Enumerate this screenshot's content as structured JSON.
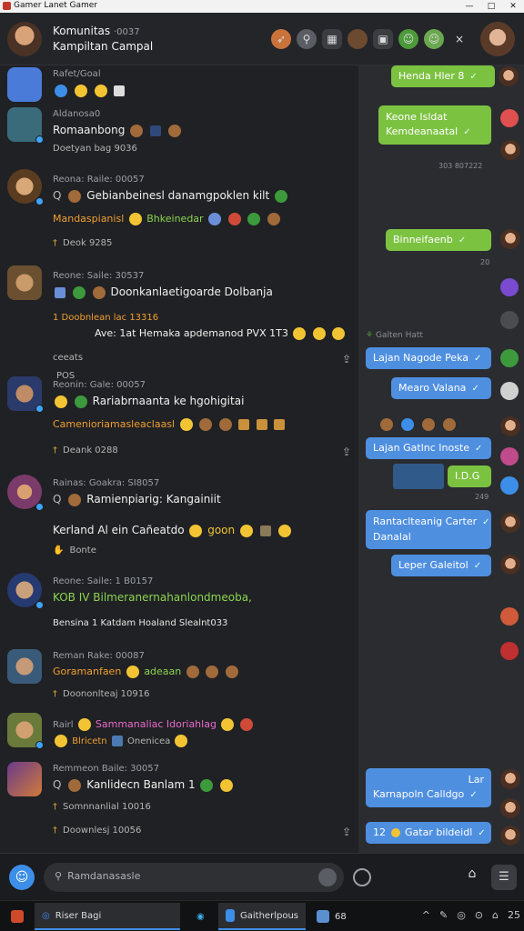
{
  "titlebar": {
    "title": "Gamer Lanet Gamer",
    "buttons": [
      "—",
      "□",
      "✕"
    ]
  },
  "header": {
    "title": "Komunitas",
    "title_meta": "·0037",
    "subtitle": "Kampiltan Campal",
    "icons": [
      "rocket-icon",
      "search-icon",
      "controller-icon",
      "avatar-icon",
      "sticker-icon",
      "emoji-icon",
      "emoji-icon",
      "close-icon"
    ],
    "close_glyph": "×"
  },
  "feed": {
    "posts": [
      {
        "meta": "Rafet/Goal",
        "line1": "",
        "line2": "",
        "footer": ""
      },
      {
        "meta": "Aldanosa0",
        "line1": "Romaanbong",
        "line2": "Doetyan bag 9036",
        "footer": ""
      },
      {
        "meta": "Reona: Raile: 00057",
        "prefix": "Q",
        "line1": "Gebianbeinesl danamgpoklen kilt",
        "line2": "Mandaspianisl",
        "line2b": "Bhkeinedar",
        "footer": "Deok 9285",
        "footer_prefix": "†"
      },
      {
        "meta": "Reone: Saile: 30537",
        "line1": "Doonkanlaetigoarde Dolbanja",
        "line2": "1 Doobnlean lac 13316",
        "line3": "Ave: 1at Hemaka apdemanod PVX 1T3",
        "footer": "POS",
        "footer_prefix": "ceeats"
      },
      {
        "meta": "Reonin: Gale: 00057",
        "line1": "Rariabrnaanta ke hgohigitai",
        "line2": "Camenioriamasleaclaasl",
        "footer": "Deank 0288",
        "footer_prefix": "†"
      },
      {
        "meta": "Rainas: Goakra: SI8057",
        "prefix": "Q",
        "line1": "Ramienpiarig: Kangainiit",
        "line2": "Kerland Al ein Cañeatdo",
        "line2b": "goon",
        "footer": "Bonte",
        "footer_prefix": "✋"
      },
      {
        "meta": "Reone: Saile: 1 B0157",
        "line1": "KOB IV Bilmeranernahanlondmeoba,",
        "line2": "Bensina 1 Katdam Hoaland Slealnt033",
        "footer": ""
      },
      {
        "meta": "Reman Rake: 00087",
        "line1": "Goramanfaen",
        "line1b": "adeaan",
        "footer": "Doononlteaj 10916",
        "footer_prefix": "†"
      },
      {
        "meta": "Rairl",
        "line1": "Sammanaliac Idoriahlag",
        "line2": "Blricetn",
        "line2b": "Onenicea",
        "footer": ""
      },
      {
        "meta": "Remmeon Baile: 30057",
        "prefix": "Q",
        "line1": "Kanlidecn Banlam 1",
        "line2": "Somnnanlial 10016",
        "line3": "Doownlesj 10056",
        "footer": ""
      }
    ]
  },
  "side": {
    "bubbles": [
      {
        "text": "Henda Hler 8",
        "color": "green"
      },
      {
        "text": "Keone Isldat",
        "text2": "Kemdeanaatal",
        "color": "green"
      },
      {
        "time": "303 807222"
      },
      {
        "text": "Binneifaenb",
        "color": "green"
      },
      {
        "time": "20"
      },
      {
        "name": "Galten Hatt"
      },
      {
        "text": "Lajan Nagode Peka",
        "color": "blue"
      },
      {
        "text": "Mearo Valana",
        "color": "blue"
      },
      {
        "text": "Lajan Gatlnc Inoste",
        "color": "blue"
      },
      {
        "text": "I.D.G",
        "color": "green"
      },
      {
        "time": "249"
      },
      {
        "text": "Rantaclteanig Carter",
        "text2": "Danalal",
        "color": "blue"
      },
      {
        "text": "Leper Galeitol",
        "color": "blue"
      },
      {
        "text": "Lar",
        "text2": "Karnapoln Calldgo",
        "color": "blue"
      },
      {
        "text": "12",
        "text2": "Gatar bildeidl",
        "color": "blue"
      }
    ]
  },
  "composer": {
    "placeholder": "Ramdanasasle"
  },
  "taskbar": {
    "items": [
      {
        "label": "Riser Bagi"
      },
      {
        "label": "Gaitherlpous"
      },
      {
        "label": "68"
      }
    ],
    "tray": [
      "^",
      "✎",
      "◎",
      "⊙",
      "⌂",
      "25"
    ]
  },
  "colors": {
    "accent_blue": "#4f8fe0",
    "accent_green": "#7cc241",
    "bg": "#202124"
  }
}
